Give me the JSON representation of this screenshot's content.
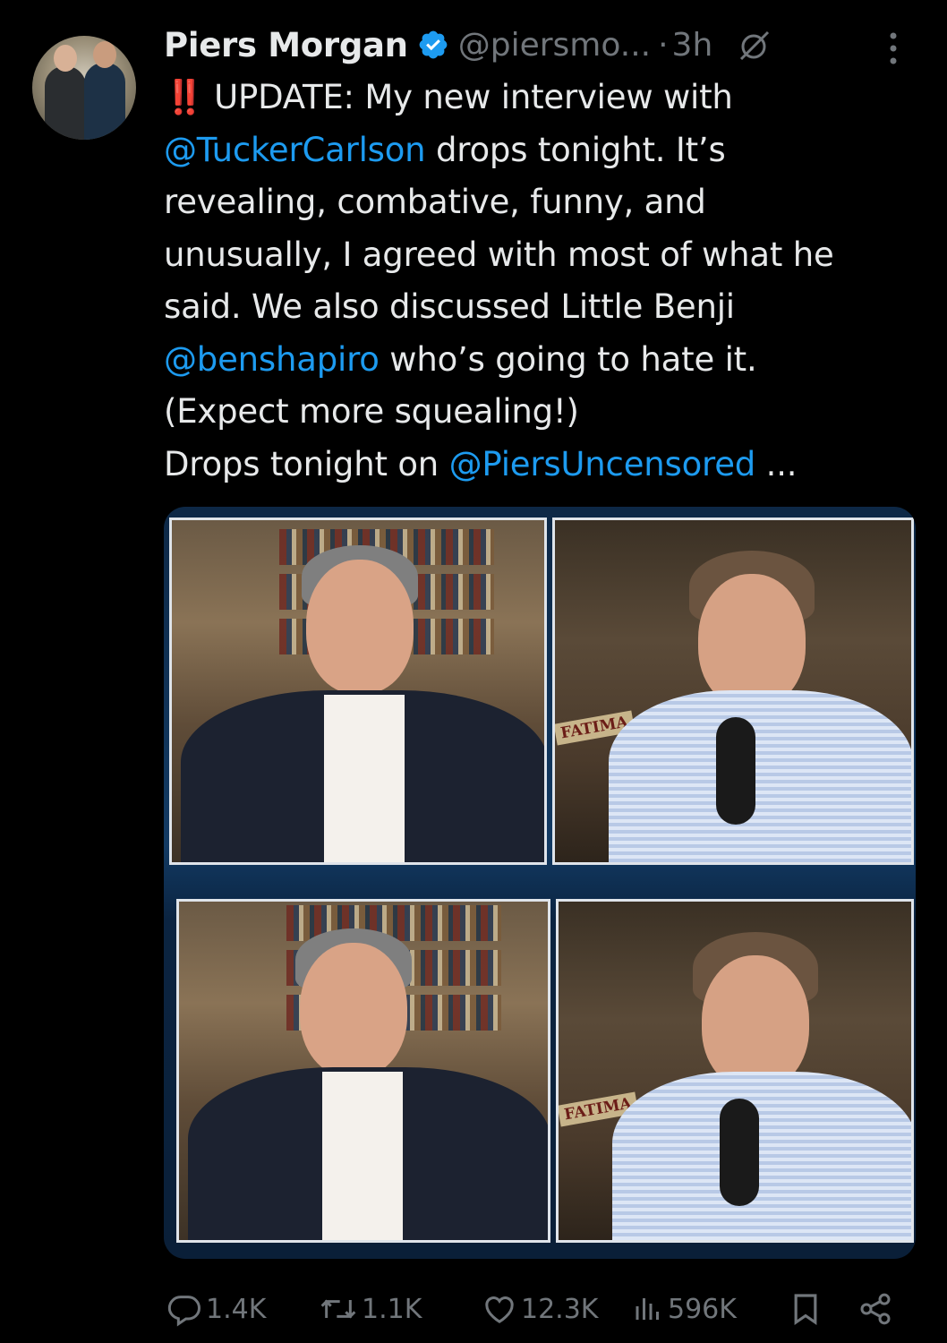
{
  "author": {
    "name": "Piers Morgan",
    "handle": "@piersmo...",
    "separator": "·",
    "time": "3h"
  },
  "tweet": {
    "bangs": "‼️",
    "lines": [
      {
        "before": "UPDATE: My new interview with",
        "mention": "",
        "after": ""
      },
      {
        "before": "",
        "mention": "@TuckerCarlson",
        "after": " drops tonight. It’s"
      },
      {
        "before": "revealing, combative, funny, and",
        "mention": "",
        "after": ""
      },
      {
        "before": "unusually, I agreed with most of what he",
        "mention": "",
        "after": ""
      },
      {
        "before": "said. We also discussed Little Benji",
        "mention": "",
        "after": ""
      },
      {
        "before": "",
        "mention": "@benshapiro",
        "after": " who’s going to hate it."
      },
      {
        "before": "(Expect more squealing!)",
        "mention": "",
        "after": ""
      },
      {
        "before": "Drops tonight on ",
        "mention": "@PiersUncensored",
        "after": " ..."
      }
    ]
  },
  "media": {
    "sign_text_1": "FATIMA",
    "sign_text_2": "FATIMA"
  },
  "actions": {
    "replies": "1.4K",
    "reposts": "1.1K",
    "likes": "12.3K",
    "views": "596K"
  },
  "colors": {
    "background": "#000000",
    "text": "#e7e9ea",
    "muted": "#71767b",
    "link": "#1d9bf0",
    "verified": "#1d9bf0"
  }
}
